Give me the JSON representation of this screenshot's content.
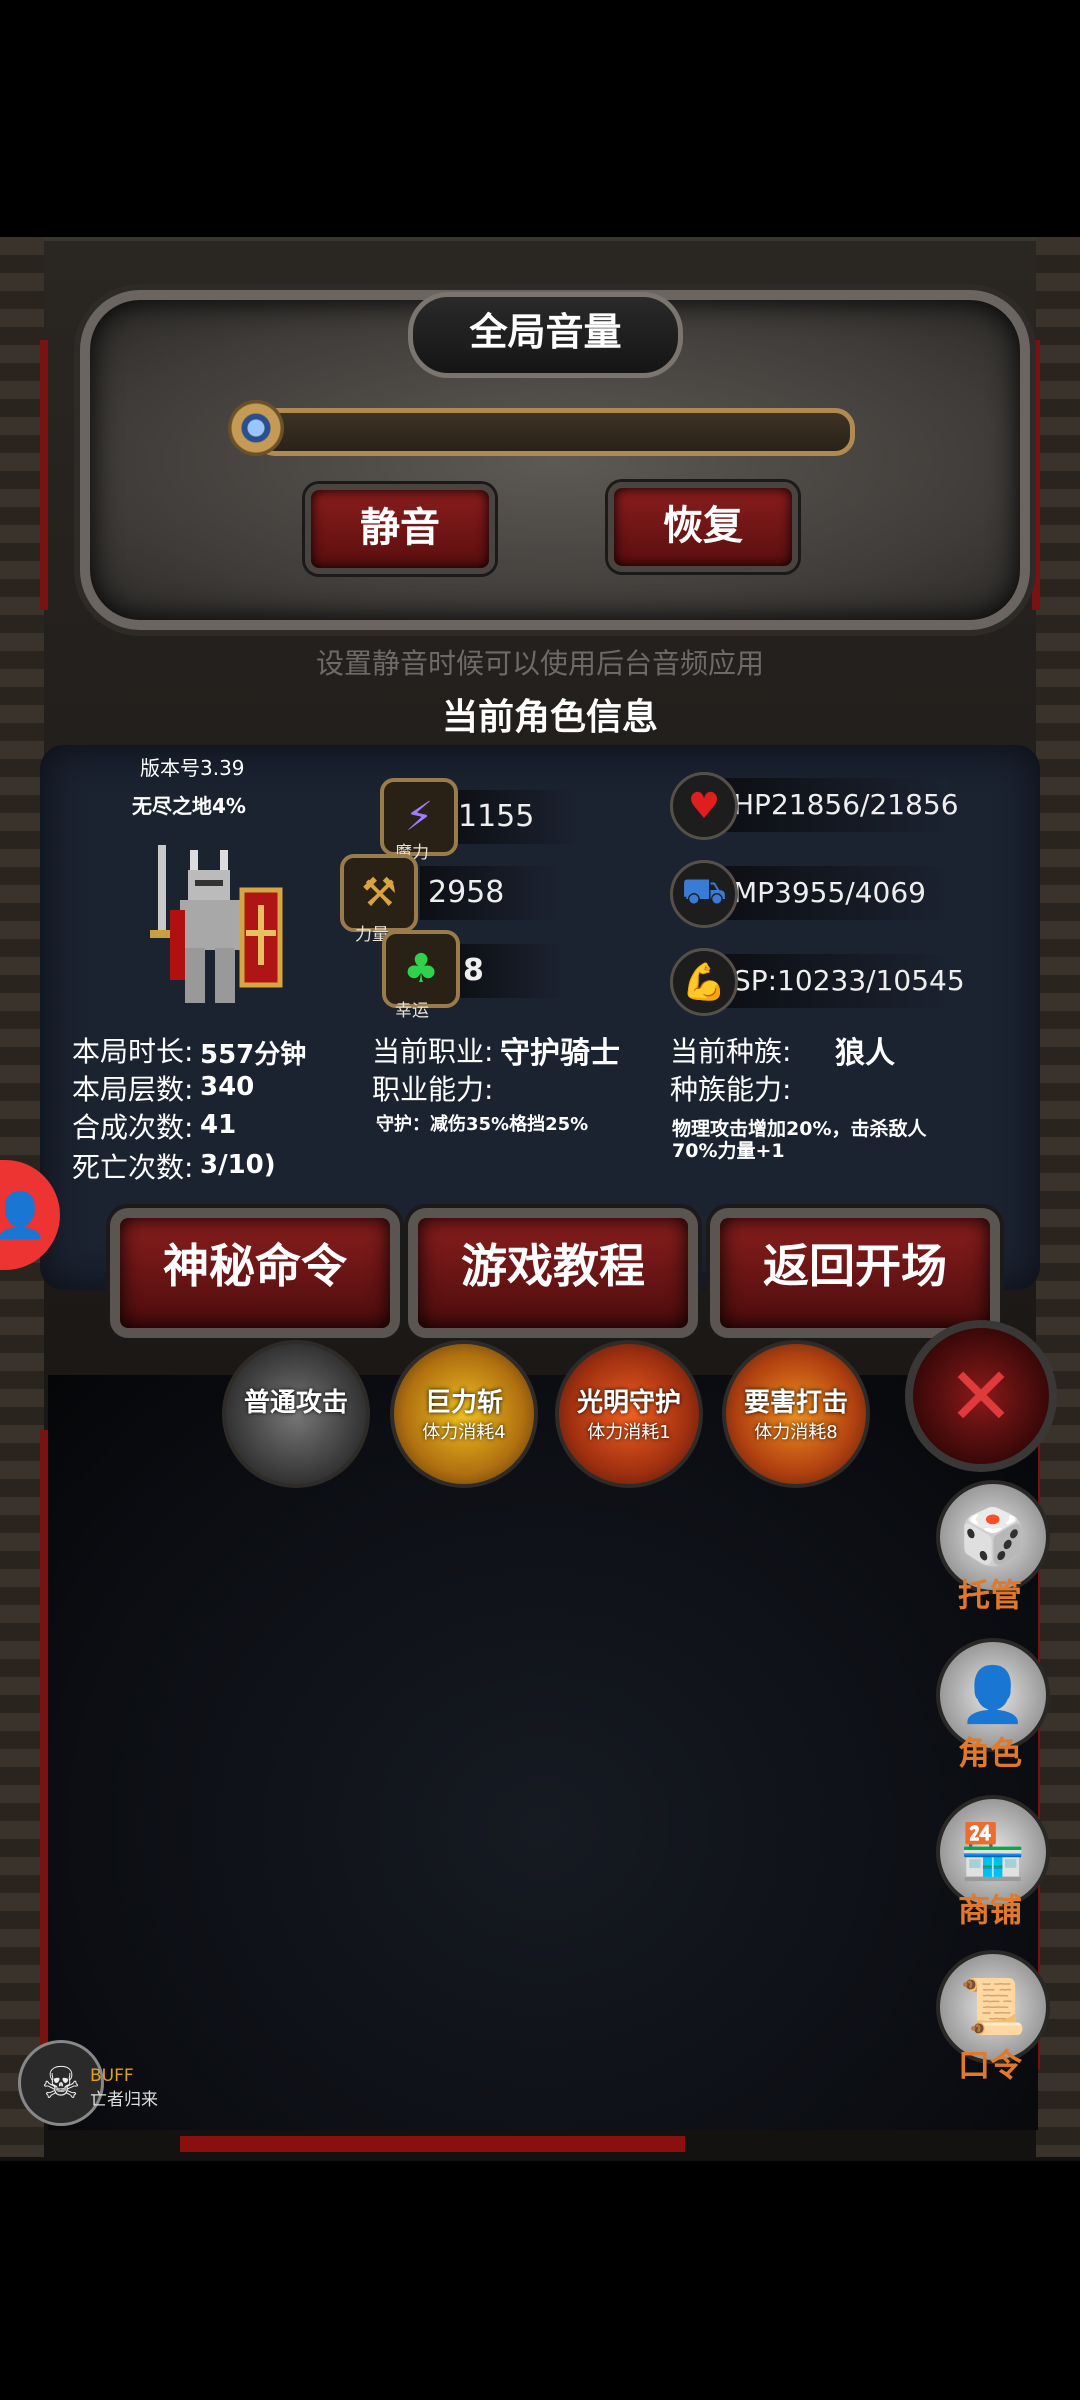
{
  "volume": {
    "title": "全局音量",
    "mute_label": "静音",
    "restore_label": "恢复",
    "hint": "设置静音时候可以使用后台音频应用"
  },
  "character": {
    "section_title": "当前角色信息",
    "version": "版本号3.39",
    "realm": "无尽之地4%",
    "stats": {
      "magic_value": "1155",
      "magic_label": "魔力",
      "strength_value": "2958",
      "strength_label": "力量",
      "luck_value": "8",
      "luck_label": "幸运"
    },
    "resources": {
      "hp": "HP21856/21856",
      "mp": "MP3955/4069",
      "sp": "SP:10233/10545"
    },
    "run_info": {
      "duration_label": "本局时长:",
      "duration_value": "557分钟",
      "floors_label": "本局层数:",
      "floors_value": "340",
      "merges_label": "合成次数:",
      "merges_value": "41",
      "deaths_label": "死亡次数:",
      "deaths_value": "3/10)"
    },
    "class_info": {
      "class_label": "当前职业:",
      "class_value": "守护骑士",
      "ability_label": "职业能力:",
      "ability_value": "守护：减伤35%格挡25%"
    },
    "race_info": {
      "race_label": "当前种族:",
      "race_value": "狼人",
      "ability_label": "种族能力:",
      "ability_value_line1": "物理攻击增加20%，击杀敌人",
      "ability_value_line2": "70%力量+1"
    }
  },
  "actions": {
    "secret_command": "神秘命令",
    "tutorial": "游戏教程",
    "return_start": "返回开场"
  },
  "skills": [
    {
      "name": "普通攻击",
      "cost": ""
    },
    {
      "name": "巨力斩",
      "cost": "体力消耗4"
    },
    {
      "name": "光明守护",
      "cost": "体力消耗1"
    },
    {
      "name": "要害打击",
      "cost": "体力消耗8"
    }
  ],
  "side_menu": {
    "auto": "托管",
    "role": "角色",
    "shop": "商铺",
    "command": "口令"
  },
  "buff": {
    "title": "BUFF",
    "name": "亡者归来"
  },
  "colors": {
    "accent_red": "#8a1d1d",
    "panel_blue": "#1b2230",
    "side_label_orange": "#e07a2a"
  }
}
